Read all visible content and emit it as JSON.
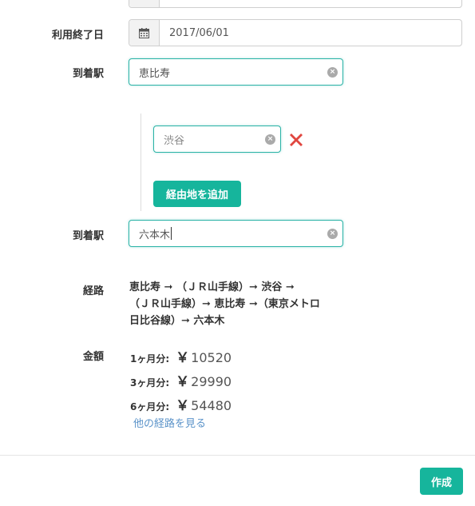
{
  "form": {
    "end_date": {
      "label": "利用終了日",
      "icon": "calendar-icon",
      "value": "2017/06/01"
    },
    "departure": {
      "label": "到着駅",
      "value": "恵比寿"
    },
    "via": {
      "value": "渋谷",
      "remove_icon": "close-icon",
      "add_label": "経由地を追加"
    },
    "arrival": {
      "label": "到着駅",
      "value": "六本木"
    }
  },
  "route": {
    "label": "経路",
    "line1": "恵比寿 ➞ （ＪＲ山手線）➞ 渋谷 ➞",
    "line2": "（ＪＲ山手線）➞ 恵比寿 ➞（東京メトロ",
    "line3": "日比谷線）➞ 六本木"
  },
  "fare": {
    "label": "金額",
    "rows": [
      {
        "period": "1ヶ月分:",
        "currency": "￥",
        "amount": "10520"
      },
      {
        "period": "3ヶ月分:",
        "currency": "￥",
        "amount": "29990"
      },
      {
        "period": "6ヶ月分:",
        "currency": "￥",
        "amount": "54480"
      }
    ],
    "other_routes_link": "他の経路を見る"
  },
  "footer": {
    "create_label": "作成"
  },
  "colors": {
    "accent": "#16b59c",
    "focus_border": "#2ab3a6",
    "link": "#5b93c9",
    "remove": "#e0463f"
  }
}
